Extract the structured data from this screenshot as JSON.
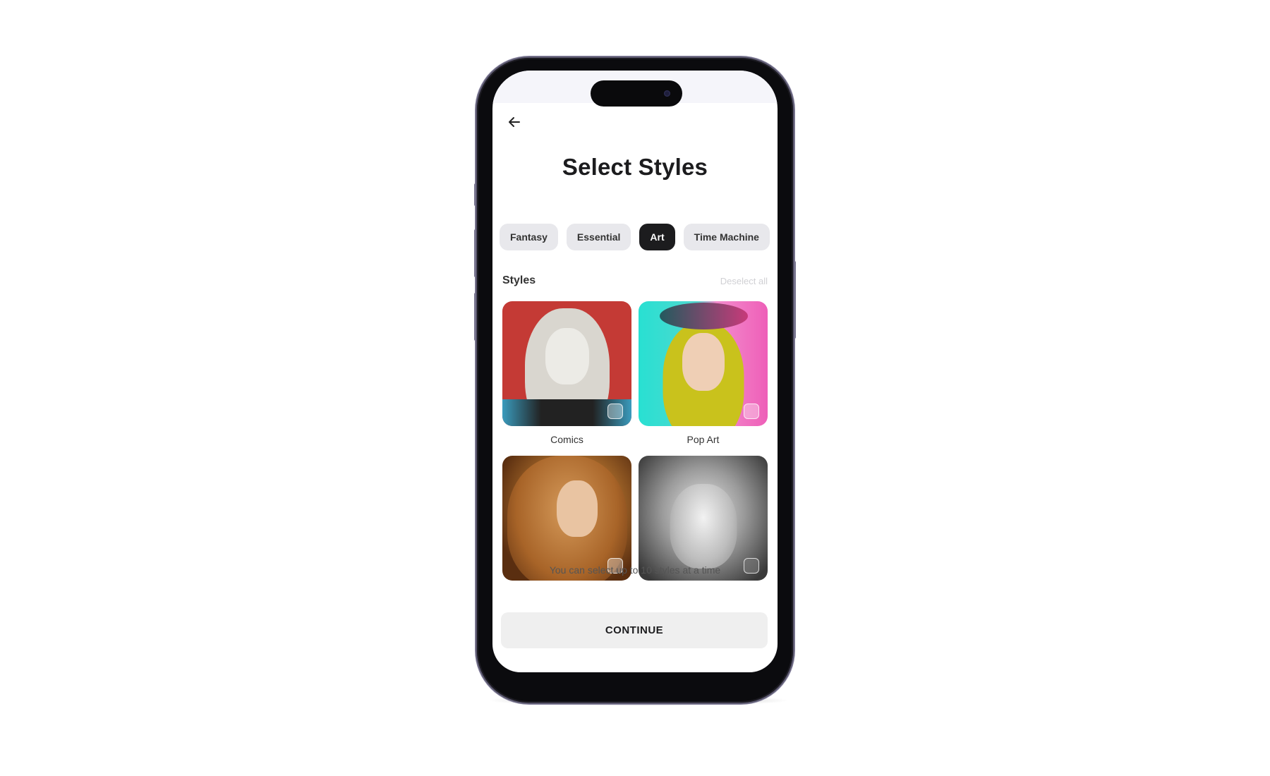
{
  "screen": {
    "title": "Select Styles",
    "back_icon": "arrow-left-icon"
  },
  "categories": [
    {
      "label": "Fantasy",
      "active": false
    },
    {
      "label": "Essential",
      "active": false
    },
    {
      "label": "Art",
      "active": true
    },
    {
      "label": "Time Machine",
      "active": false
    }
  ],
  "styles_section": {
    "label": "Styles",
    "deselect_all": "Deselect all"
  },
  "styles": [
    {
      "label": "Comics",
      "selected": false
    },
    {
      "label": "Pop Art",
      "selected": false
    },
    {
      "label": "",
      "selected": false
    },
    {
      "label": "",
      "selected": false
    }
  ],
  "footer": {
    "hint": "You can select up to 10 styles at a time",
    "continue_label": "CONTINUE"
  },
  "colors": {
    "active_chip": "#1c1c1e",
    "chip": "#e8e8ec",
    "button": "#efefef"
  }
}
